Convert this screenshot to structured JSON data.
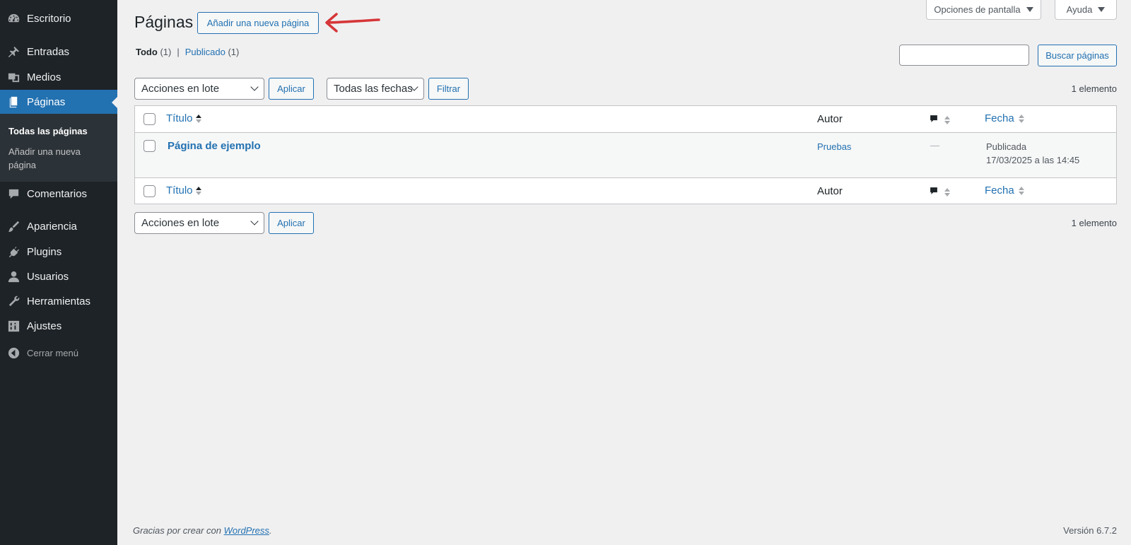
{
  "sidebar": {
    "items": [
      {
        "label": "Escritorio",
        "icon": "dashboard-icon"
      },
      {
        "label": "Entradas",
        "icon": "pin-icon"
      },
      {
        "label": "Medios",
        "icon": "media-icon"
      },
      {
        "label": "Páginas",
        "icon": "pages-icon"
      },
      {
        "label": "Comentarios",
        "icon": "comment-icon"
      },
      {
        "label": "Apariencia",
        "icon": "brush-icon"
      },
      {
        "label": "Plugins",
        "icon": "plug-icon"
      },
      {
        "label": "Usuarios",
        "icon": "user-icon"
      },
      {
        "label": "Herramientas",
        "icon": "wrench-icon"
      },
      {
        "label": "Ajustes",
        "icon": "settings-icon"
      }
    ],
    "submenu": {
      "all_pages": "Todas las páginas",
      "add_new_line1": "Añadir una nueva",
      "add_new_line2": "página"
    },
    "collapse_label": "Cerrar menú"
  },
  "header": {
    "title": "Páginas",
    "add_new_label": "Añadir una nueva página",
    "screen_options_label": "Opciones de pantalla",
    "help_label": "Ayuda"
  },
  "filters": {
    "all_label": "Todo",
    "all_count": "(1)",
    "separator": "|",
    "published_label": "Publicado",
    "published_count": "(1)"
  },
  "search": {
    "placeholder": "",
    "button_label": "Buscar páginas"
  },
  "toolbar": {
    "bulk_actions": "Acciones en lote",
    "apply_label": "Aplicar",
    "dates_label": "Todas las fechas",
    "filter_label": "Filtrar",
    "items_count": "1 elemento"
  },
  "table": {
    "columns": {
      "title": "Título",
      "author": "Autor",
      "date": "Fecha"
    },
    "rows": [
      {
        "title": "Página de ejemplo",
        "author": "Pruebas",
        "comments": "—",
        "status": "Publicada",
        "date": "17/03/2025 a las 14:45"
      }
    ]
  },
  "footer": {
    "thanks_prefix": "Gracias por crear con ",
    "wordpress_link": "WordPress",
    "thanks_suffix": ".",
    "version": "Versión 6.7.2"
  },
  "colors": {
    "sidebar_bg": "#1d2327",
    "accent": "#2271b1",
    "annotation_arrow": "#d63638"
  }
}
